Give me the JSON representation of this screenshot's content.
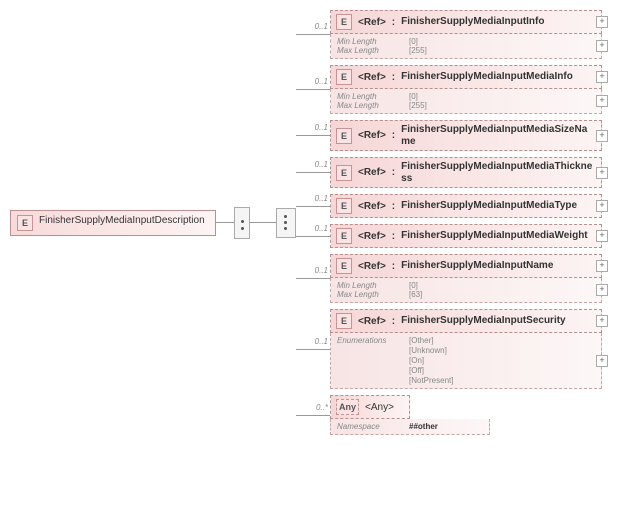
{
  "root": {
    "badge": "E",
    "label": "FinisherSupplyMediaInputDescription"
  },
  "refText": "<Ref>",
  "anyBadge": "Any",
  "anyText": "<Any>",
  "children": [
    {
      "occ": "0..1",
      "type": "FinisherSupplyMediaInputInfo",
      "facets": [
        {
          "k": "Min Length",
          "v": "[0]"
        },
        {
          "k": "Max Length",
          "v": "[255]"
        }
      ],
      "plus": true
    },
    {
      "occ": "0..1",
      "type": "FinisherSupplyMediaInputMediaInfo",
      "facets": [
        {
          "k": "Min Length",
          "v": "[0]"
        },
        {
          "k": "Max Length",
          "v": "[255]"
        }
      ],
      "plus": true
    },
    {
      "occ": "0..1",
      "type": "FinisherSupplyMediaInputMediaSizeName",
      "facets": null,
      "plus": true
    },
    {
      "occ": "0..1",
      "type": "FinisherSupplyMediaInputMediaThickness",
      "facets": null,
      "plus": true
    },
    {
      "occ": "0..1",
      "type": "FinisherSupplyMediaInputMediaType",
      "facets": null,
      "plus": true
    },
    {
      "occ": "0..1",
      "type": "FinisherSupplyMediaInputMediaWeight",
      "facets": null,
      "plus": true
    },
    {
      "occ": "0..1",
      "type": "FinisherSupplyMediaInputName",
      "facets": [
        {
          "k": "Min Length",
          "v": "[0]"
        },
        {
          "k": "Max Length",
          "v": "[63]"
        }
      ],
      "plus": true
    },
    {
      "occ": "0..1",
      "type": "FinisherSupplyMediaInputSecurity",
      "enumLabel": "Enumerations",
      "enums": [
        "[Other]",
        "[Unknown]",
        "[On]",
        "[Off]",
        "[NotPresent]"
      ],
      "plus": true
    }
  ],
  "anyChild": {
    "occ": "0..*",
    "namespaceLabel": "Namespace",
    "namespaceValue": "##other"
  }
}
